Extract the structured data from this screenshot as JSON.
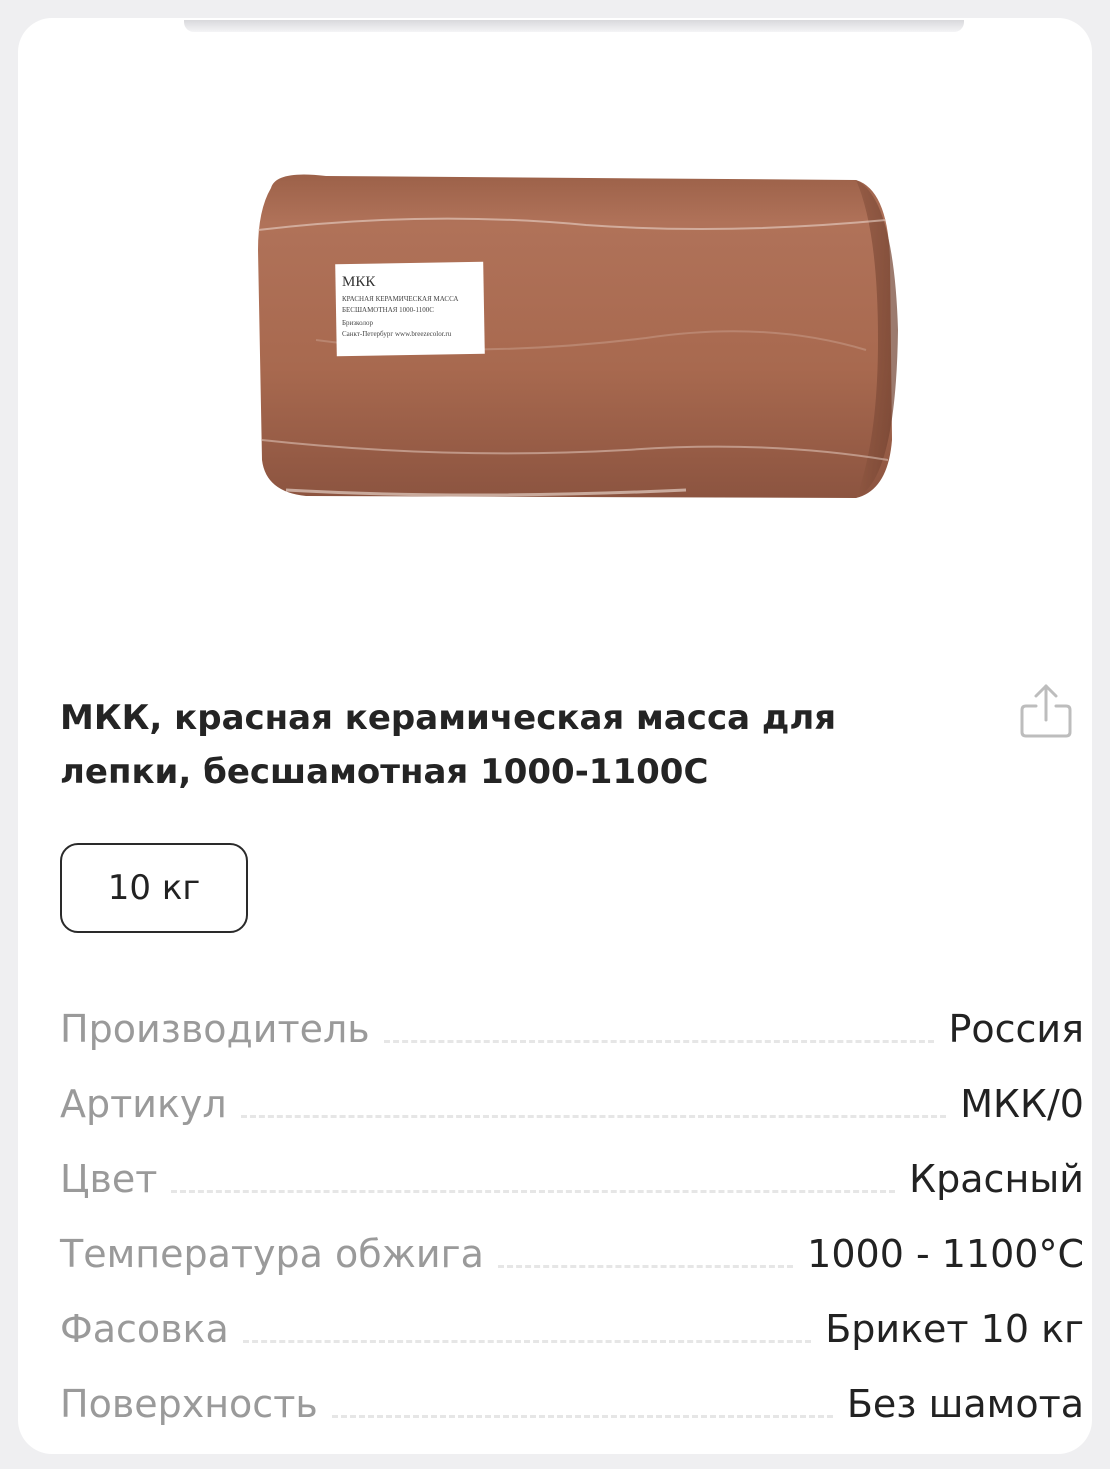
{
  "product": {
    "title": "МКК, красная керамическая масса для лепки, бесшамотная 1000-1100С",
    "image_label": {
      "brand": "МКК",
      "line1": "КРАСНАЯ КЕРАМИЧЕСКАЯ МАССА",
      "line2": "БЕСШАМОТНАЯ 1000-1100С",
      "line3": "Бризколор",
      "line4": "Санкт-Петербург   www.breezecolor.ru"
    },
    "variant_selected": "10 кг"
  },
  "specs": [
    {
      "label": "Производитель",
      "value": "Россия"
    },
    {
      "label": "Артикул",
      "value": "МКК/0"
    },
    {
      "label": "Цвет",
      "value": "Красный"
    },
    {
      "label": "Температура обжига",
      "value": "1000 - 1100°С"
    },
    {
      "label": "Фасовка",
      "value": "Брикет 10 кг"
    },
    {
      "label": "Поверхность",
      "value": "Без шамота"
    }
  ],
  "colors": {
    "clay": "#a5684e",
    "label_text": "#9a9a9a"
  },
  "icons": {
    "share": "share-icon"
  }
}
